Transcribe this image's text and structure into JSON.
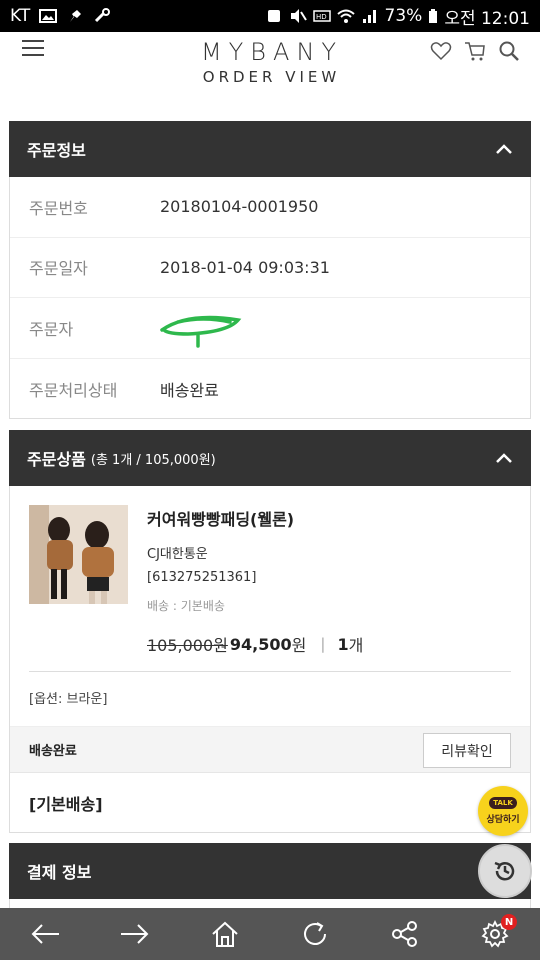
{
  "statusbar": {
    "carrier": "KT",
    "battery": "73%",
    "time": "오전 12:01"
  },
  "header": {
    "brand": "MYBANY",
    "subtitle": "ORDER VIEW"
  },
  "order_info": {
    "title": "주문정보",
    "rows": [
      {
        "label": "주문번호",
        "value": "20180104-0001950"
      },
      {
        "label": "주문일자",
        "value": "2018-01-04 09:03:31"
      },
      {
        "label": "주문자",
        "value": ""
      },
      {
        "label": "주문처리상태",
        "value": "배송완료"
      }
    ]
  },
  "order_items": {
    "title": "주문상품",
    "summary": "(총 1개 / 105,000원)",
    "product": {
      "name": "커여워빵빵패딩(웰론)",
      "carrier": "CJ대한통운",
      "tracking": "[613275251361]",
      "ship_method": "배송 : 기본배송",
      "original_price": "105,000원",
      "sale_price": "94,500",
      "won": "원",
      "divider": "|",
      "quantity": "1",
      "qty_unit": "개",
      "option": "[옵션: 브라운]",
      "status": "배송완료",
      "review_label": "리뷰확인",
      "shipping_group": "[기본배송]"
    }
  },
  "payment": {
    "title": "결제 정보"
  },
  "kakao": {
    "talk": "TALK",
    "label": "상담하기"
  },
  "bottomnav": {
    "badge": "N"
  },
  "colors": {
    "section_header": "#333333",
    "kakao": "#f7d21c",
    "nav": "#555555"
  }
}
